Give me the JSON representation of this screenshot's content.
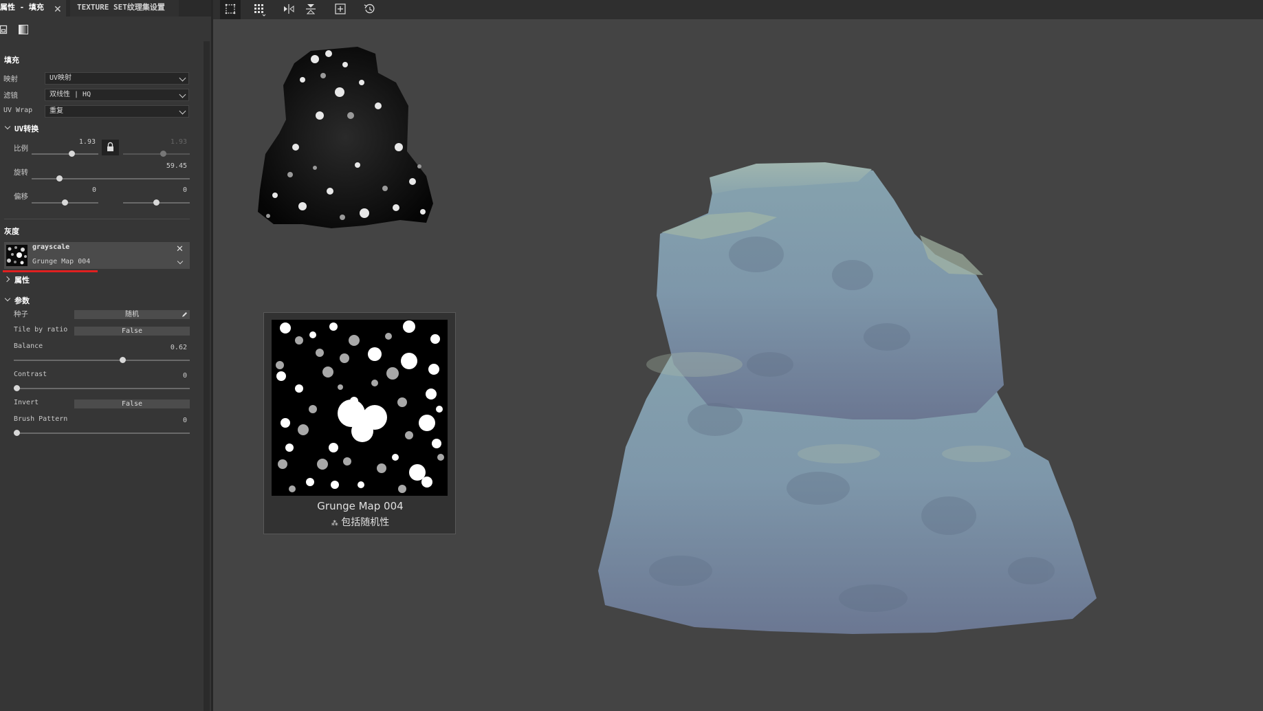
{
  "tabs": [
    {
      "label": "属性 - 填充"
    },
    {
      "label": "TEXTURE SET纹理集设置"
    }
  ],
  "fill": {
    "section_title": "填充",
    "mapping_label": "映射",
    "mapping_value": "UV映射",
    "filter_label": "滤镜",
    "filter_value": "双线性 | HQ",
    "uvwrap_label": "UV Wrap",
    "uvwrap_value": "重复"
  },
  "uv_transform": {
    "section_title": "UV转换",
    "scale_label": "比例",
    "scale_value": "1.93",
    "scale_value_2": "1.93",
    "rotation_label": "旋转",
    "rotation_value": "59.45",
    "offset_label": "偏移",
    "offset_value": "0",
    "offset_value_2": "0"
  },
  "grayscale": {
    "section_title": "灰度",
    "resource_name": "grayscale",
    "resource_sub": "Grunge Map 004",
    "properties_label": "属性"
  },
  "params": {
    "section_title": "参数",
    "seed_label": "种子",
    "seed_value": "随机",
    "tile_label": "Tile by ratio",
    "tile_value": "False",
    "balance_label": "Balance",
    "balance_value": "0.62",
    "balance_fraction": 0.62,
    "contrast_label": "Contrast",
    "contrast_value": "0",
    "invert_label": "Invert",
    "invert_value": "False",
    "brush_label": "Brush Pattern",
    "brush_value": "0"
  },
  "toolbar": {
    "icons": [
      "select-icon",
      "grid-icon",
      "mirror-horizontal-icon",
      "mirror-vertical-icon",
      "add-frame-icon",
      "reset-icon"
    ]
  },
  "preview_card": {
    "name": "Grunge Map 004",
    "subtitle": "包括随机性"
  },
  "colors": {
    "panel_bg": "#363636",
    "viewport_bg": "#444444",
    "highlight_underline": "#e02020",
    "rock_tint": "#7f95a8"
  }
}
